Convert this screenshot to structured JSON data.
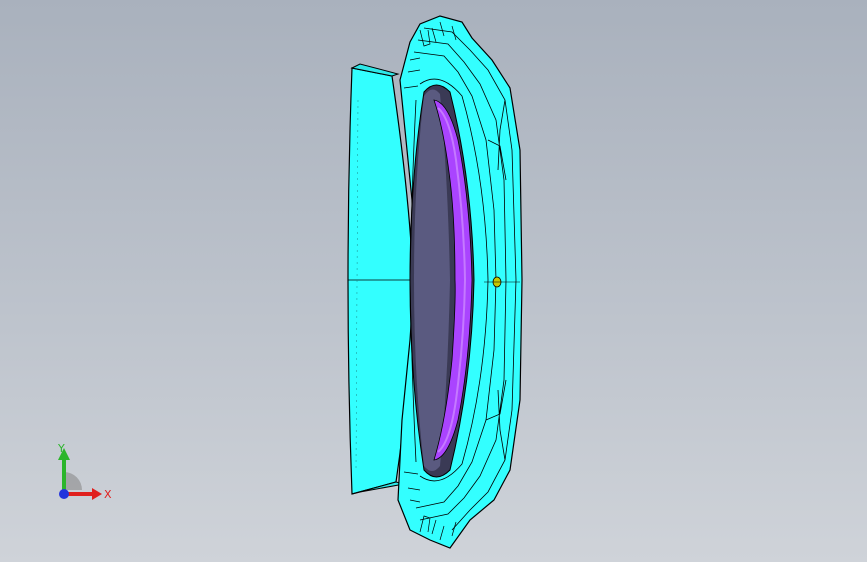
{
  "viewport": {
    "background_top": "#a9b1bd",
    "background_bottom": "#cfd3d9"
  },
  "model": {
    "part_color": "#33ffff",
    "inner_band_color": "#aa44ff",
    "edge_color": "#000000",
    "origin_marker_color": "#c8c800"
  },
  "triad": {
    "x_label": "X",
    "y_label": "Y",
    "x_color": "#e0201e",
    "y_color": "#2bb52b",
    "z_color": "#2233dd"
  }
}
